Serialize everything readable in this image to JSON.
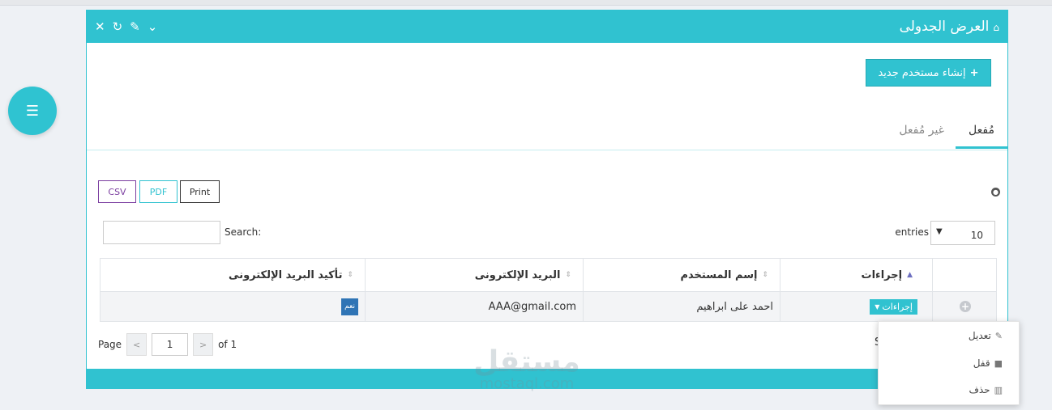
{
  "panel": {
    "title": "العرض الجدولى",
    "icons": [
      "home-icon",
      "close-icon",
      "refresh-icon",
      "wrench-icon",
      "chevron-down-icon"
    ]
  },
  "toolbar": {
    "create_label": "إنشاء مستخدم جديد"
  },
  "tabs": [
    {
      "label": "مُفعل",
      "active": true
    },
    {
      "label": "غير مُفعل",
      "active": false
    }
  ],
  "export": {
    "csv": "CSV",
    "pdf": "PDF",
    "print": "Print"
  },
  "controls": {
    "search_label": "Search:",
    "entries_label": "entries",
    "entries_value": "10"
  },
  "table": {
    "headers": {
      "actions": "إجراءات",
      "username": "إسم المستخدم",
      "email": "البريد الإلكترونى",
      "email_confirmed": "تأكيد البريد الإلكترونى"
    },
    "rows": [
      {
        "actions_button": "إجراءات",
        "username": "احمد على ابراهيم",
        "email": "AAA@gmail.com",
        "confirmed": "نعم"
      }
    ]
  },
  "pagination": {
    "page_label": "Page",
    "page_value": "1",
    "of_label": "of 1",
    "prev": "<",
    "next": ">"
  },
  "stray_text": "S",
  "dropdown": {
    "items": [
      {
        "label": "تعديل",
        "icon": "pencil-icon"
      },
      {
        "label": "قفل",
        "icon": "lock-icon"
      },
      {
        "label": "حذف",
        "icon": "trash-icon"
      }
    ]
  },
  "watermark": {
    "arabic": "مستقل",
    "latin": "mostaql.com"
  },
  "colors": {
    "accent": "#30c2d0",
    "csv": "#7b3ea0",
    "badge": "#2f74b5"
  }
}
